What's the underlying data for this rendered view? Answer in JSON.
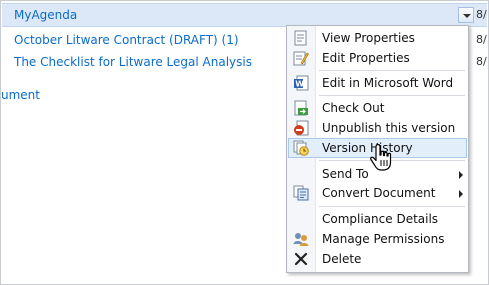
{
  "list": {
    "items": [
      {
        "title": "MyAgenda",
        "date": "8/"
      },
      {
        "title": "October Litware Contract (DRAFT) (1)",
        "date": "8/"
      },
      {
        "title": "The Checklist for Litware Legal Analysis",
        "date": "8/"
      },
      {
        "title": "ument",
        "date": ""
      }
    ]
  },
  "menu": {
    "items": [
      {
        "label": "View Properties",
        "icon": "view-properties-icon"
      },
      {
        "label": "Edit Properties",
        "icon": "edit-properties-icon"
      },
      {
        "label": "Edit in Microsoft Word",
        "icon": "word-icon"
      },
      {
        "label": "Check Out",
        "icon": "check-out-icon"
      },
      {
        "label": "Unpublish this version",
        "icon": "unpublish-icon"
      },
      {
        "label": "Version History",
        "icon": "version-history-icon",
        "highlighted": true
      },
      {
        "label": "Send To",
        "icon": "",
        "submenu": true
      },
      {
        "label": "Convert Document",
        "icon": "convert-document-icon",
        "submenu": true
      },
      {
        "label": "Compliance Details",
        "icon": ""
      },
      {
        "label": "Manage Permissions",
        "icon": "manage-permissions-icon"
      },
      {
        "label": "Delete",
        "icon": "delete-icon"
      }
    ]
  },
  "colors": {
    "link": "#0a6cc9",
    "selected_row": "#dce8f7",
    "menu_highlight": "#e3eefb"
  }
}
